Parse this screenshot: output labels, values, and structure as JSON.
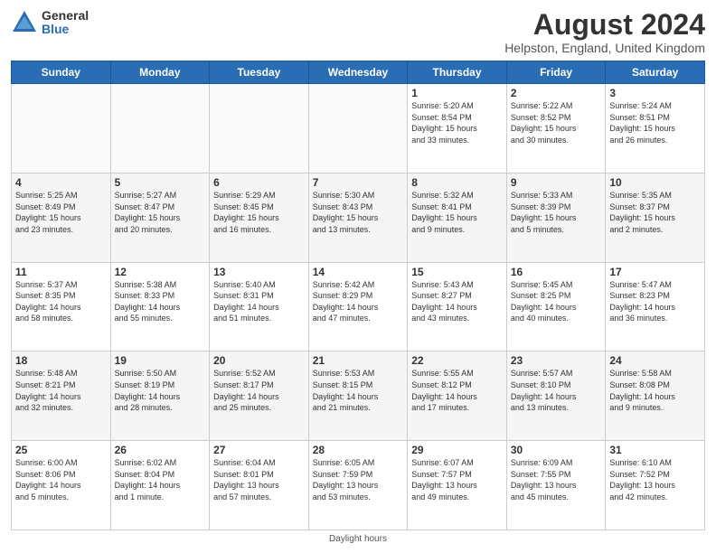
{
  "header": {
    "logo_general": "General",
    "logo_blue": "Blue",
    "month_title": "August 2024",
    "location": "Helpston, England, United Kingdom"
  },
  "weekdays": [
    "Sunday",
    "Monday",
    "Tuesday",
    "Wednesday",
    "Thursday",
    "Friday",
    "Saturday"
  ],
  "footer": {
    "daylight_label": "Daylight hours"
  },
  "weeks": [
    [
      {
        "day": "",
        "info": ""
      },
      {
        "day": "",
        "info": ""
      },
      {
        "day": "",
        "info": ""
      },
      {
        "day": "",
        "info": ""
      },
      {
        "day": "1",
        "info": "Sunrise: 5:20 AM\nSunset: 8:54 PM\nDaylight: 15 hours\nand 33 minutes."
      },
      {
        "day": "2",
        "info": "Sunrise: 5:22 AM\nSunset: 8:52 PM\nDaylight: 15 hours\nand 30 minutes."
      },
      {
        "day": "3",
        "info": "Sunrise: 5:24 AM\nSunset: 8:51 PM\nDaylight: 15 hours\nand 26 minutes."
      }
    ],
    [
      {
        "day": "4",
        "info": "Sunrise: 5:25 AM\nSunset: 8:49 PM\nDaylight: 15 hours\nand 23 minutes."
      },
      {
        "day": "5",
        "info": "Sunrise: 5:27 AM\nSunset: 8:47 PM\nDaylight: 15 hours\nand 20 minutes."
      },
      {
        "day": "6",
        "info": "Sunrise: 5:29 AM\nSunset: 8:45 PM\nDaylight: 15 hours\nand 16 minutes."
      },
      {
        "day": "7",
        "info": "Sunrise: 5:30 AM\nSunset: 8:43 PM\nDaylight: 15 hours\nand 13 minutes."
      },
      {
        "day": "8",
        "info": "Sunrise: 5:32 AM\nSunset: 8:41 PM\nDaylight: 15 hours\nand 9 minutes."
      },
      {
        "day": "9",
        "info": "Sunrise: 5:33 AM\nSunset: 8:39 PM\nDaylight: 15 hours\nand 5 minutes."
      },
      {
        "day": "10",
        "info": "Sunrise: 5:35 AM\nSunset: 8:37 PM\nDaylight: 15 hours\nand 2 minutes."
      }
    ],
    [
      {
        "day": "11",
        "info": "Sunrise: 5:37 AM\nSunset: 8:35 PM\nDaylight: 14 hours\nand 58 minutes."
      },
      {
        "day": "12",
        "info": "Sunrise: 5:38 AM\nSunset: 8:33 PM\nDaylight: 14 hours\nand 55 minutes."
      },
      {
        "day": "13",
        "info": "Sunrise: 5:40 AM\nSunset: 8:31 PM\nDaylight: 14 hours\nand 51 minutes."
      },
      {
        "day": "14",
        "info": "Sunrise: 5:42 AM\nSunset: 8:29 PM\nDaylight: 14 hours\nand 47 minutes."
      },
      {
        "day": "15",
        "info": "Sunrise: 5:43 AM\nSunset: 8:27 PM\nDaylight: 14 hours\nand 43 minutes."
      },
      {
        "day": "16",
        "info": "Sunrise: 5:45 AM\nSunset: 8:25 PM\nDaylight: 14 hours\nand 40 minutes."
      },
      {
        "day": "17",
        "info": "Sunrise: 5:47 AM\nSunset: 8:23 PM\nDaylight: 14 hours\nand 36 minutes."
      }
    ],
    [
      {
        "day": "18",
        "info": "Sunrise: 5:48 AM\nSunset: 8:21 PM\nDaylight: 14 hours\nand 32 minutes."
      },
      {
        "day": "19",
        "info": "Sunrise: 5:50 AM\nSunset: 8:19 PM\nDaylight: 14 hours\nand 28 minutes."
      },
      {
        "day": "20",
        "info": "Sunrise: 5:52 AM\nSunset: 8:17 PM\nDaylight: 14 hours\nand 25 minutes."
      },
      {
        "day": "21",
        "info": "Sunrise: 5:53 AM\nSunset: 8:15 PM\nDaylight: 14 hours\nand 21 minutes."
      },
      {
        "day": "22",
        "info": "Sunrise: 5:55 AM\nSunset: 8:12 PM\nDaylight: 14 hours\nand 17 minutes."
      },
      {
        "day": "23",
        "info": "Sunrise: 5:57 AM\nSunset: 8:10 PM\nDaylight: 14 hours\nand 13 minutes."
      },
      {
        "day": "24",
        "info": "Sunrise: 5:58 AM\nSunset: 8:08 PM\nDaylight: 14 hours\nand 9 minutes."
      }
    ],
    [
      {
        "day": "25",
        "info": "Sunrise: 6:00 AM\nSunset: 8:06 PM\nDaylight: 14 hours\nand 5 minutes."
      },
      {
        "day": "26",
        "info": "Sunrise: 6:02 AM\nSunset: 8:04 PM\nDaylight: 14 hours\nand 1 minute."
      },
      {
        "day": "27",
        "info": "Sunrise: 6:04 AM\nSunset: 8:01 PM\nDaylight: 13 hours\nand 57 minutes."
      },
      {
        "day": "28",
        "info": "Sunrise: 6:05 AM\nSunset: 7:59 PM\nDaylight: 13 hours\nand 53 minutes."
      },
      {
        "day": "29",
        "info": "Sunrise: 6:07 AM\nSunset: 7:57 PM\nDaylight: 13 hours\nand 49 minutes."
      },
      {
        "day": "30",
        "info": "Sunrise: 6:09 AM\nSunset: 7:55 PM\nDaylight: 13 hours\nand 45 minutes."
      },
      {
        "day": "31",
        "info": "Sunrise: 6:10 AM\nSunset: 7:52 PM\nDaylight: 13 hours\nand 42 minutes."
      }
    ]
  ]
}
